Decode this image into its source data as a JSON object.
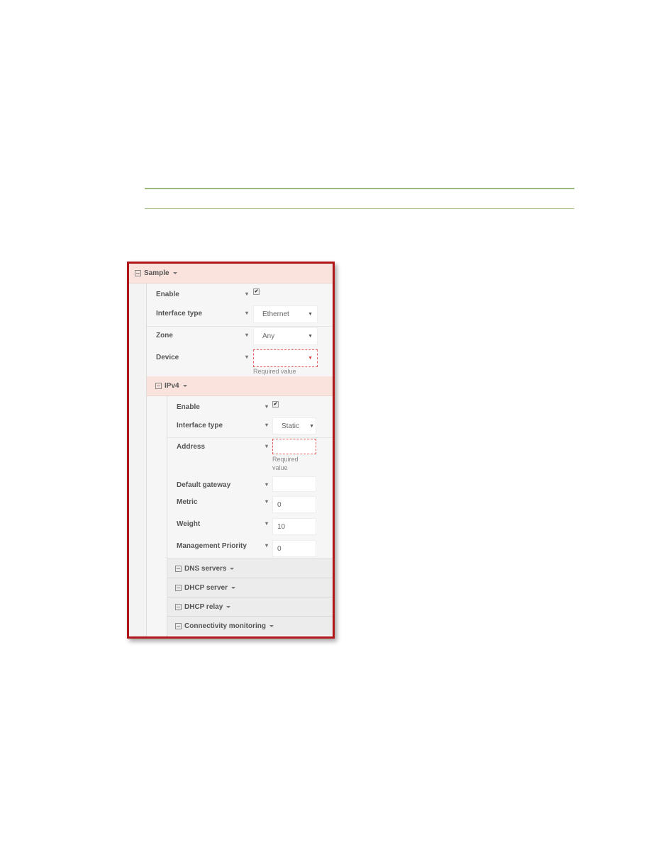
{
  "colors": {
    "rule": "#9bbb7e",
    "frame_border": "#b0151a",
    "section_header_bg": "#fbe3dd",
    "required_border": "#e06060"
  },
  "sample": {
    "title": "Sample",
    "fields": [
      {
        "label": "Enable",
        "type": "checkbox",
        "checked": true
      },
      {
        "label": "Interface type",
        "type": "select",
        "value": "Ethernet"
      },
      {
        "label": "Zone",
        "type": "select",
        "value": "Any"
      },
      {
        "label": "Device",
        "type": "select",
        "value": "",
        "error": "Required value"
      }
    ]
  },
  "ipv4": {
    "title": "IPv4",
    "fields": [
      {
        "label": "Enable",
        "type": "checkbox",
        "checked": true
      },
      {
        "label": "Interface type",
        "type": "select",
        "value": "Static"
      },
      {
        "label": "Address",
        "type": "text",
        "value": "",
        "error": "Required value"
      },
      {
        "label": "Default gateway",
        "type": "text",
        "value": ""
      },
      {
        "label": "Metric",
        "type": "text",
        "value": "0"
      },
      {
        "label": "Weight",
        "type": "text",
        "value": "10"
      },
      {
        "label": "Management Priority",
        "type": "text",
        "value": "0"
      }
    ],
    "collapsed_sections": [
      "DNS servers",
      "DHCP server",
      "DHCP relay",
      "Connectivity monitoring"
    ]
  },
  "icons": {
    "collapse": "minus-square-icon",
    "caret": "caret-down-icon",
    "dropdown": "triangle-down-icon",
    "check": "✔",
    "select_arrow": "▼"
  }
}
